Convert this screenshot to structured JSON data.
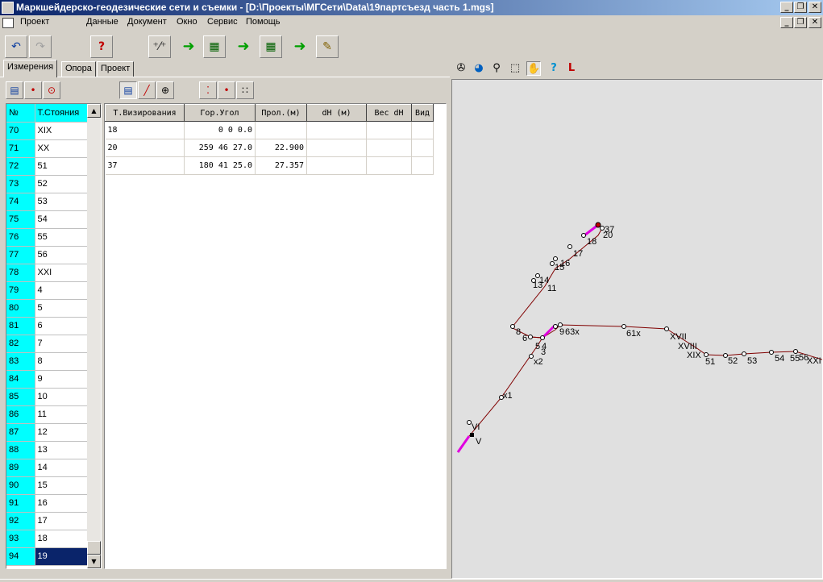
{
  "window": {
    "title": "Маркшейдерско-геодезические сети и съемки - [D:\\Проекты\\МГСети\\Data\\19партсъезд часть 1.mgs]",
    "btn_min": "_",
    "btn_restore": "❐",
    "btn_close": "✕"
  },
  "menu": {
    "doc_label": "Проект",
    "items": [
      "Данные",
      "Документ",
      "Окно",
      "Сервис",
      "Помощь"
    ]
  },
  "tabs": [
    "Измерения",
    "Опора",
    "Проект"
  ],
  "station_grid": {
    "col_num": "№",
    "col_station": "Т.Стояния",
    "rows": [
      {
        "n": "70",
        "s": "XIX"
      },
      {
        "n": "71",
        "s": "XX"
      },
      {
        "n": "72",
        "s": "51"
      },
      {
        "n": "73",
        "s": "52"
      },
      {
        "n": "74",
        "s": "53"
      },
      {
        "n": "75",
        "s": "54"
      },
      {
        "n": "76",
        "s": "55"
      },
      {
        "n": "77",
        "s": "56"
      },
      {
        "n": "78",
        "s": "XXI"
      },
      {
        "n": "79",
        "s": "4"
      },
      {
        "n": "80",
        "s": "5"
      },
      {
        "n": "81",
        "s": "6"
      },
      {
        "n": "82",
        "s": "7"
      },
      {
        "n": "83",
        "s": "8"
      },
      {
        "n": "84",
        "s": "9"
      },
      {
        "n": "85",
        "s": "10"
      },
      {
        "n": "86",
        "s": "11"
      },
      {
        "n": "87",
        "s": "12"
      },
      {
        "n": "88",
        "s": "13"
      },
      {
        "n": "89",
        "s": "14"
      },
      {
        "n": "90",
        "s": "15"
      },
      {
        "n": "91",
        "s": "16"
      },
      {
        "n": "92",
        "s": "17"
      },
      {
        "n": "93",
        "s": "18"
      },
      {
        "n": "94",
        "s": "19"
      }
    ],
    "selected_row": "94"
  },
  "measurement_grid": {
    "headers": [
      "Т.Визирования",
      "Гор.Угол",
      "Прол.(м)",
      "dH (м)",
      "Вес dH",
      "Вид"
    ],
    "rows": [
      [
        "18",
        "0  0  0.0",
        "",
        "",
        "",
        ""
      ],
      [
        "20",
        "259 46 27.0",
        "22.900",
        "",
        "",
        ""
      ],
      [
        "37",
        "180 41 25.0",
        "27.357",
        "",
        "",
        ""
      ]
    ]
  },
  "map_labels": {
    "p37": "37",
    "p20": "20",
    "p18": "18",
    "p17": "17",
    "p16": "16",
    "p15": "15",
    "p14": "14",
    "p13": "13",
    "p11": "11",
    "p8": "8",
    "p6": "6",
    "p5": "5",
    "p4": "4",
    "p3": "3",
    "p9": "9",
    "p63x": "63x",
    "p61x": "61x",
    "pXVII": "XVII",
    "pXVIII": "XVIII",
    "pXIX": "XIX",
    "p51": "51",
    "p52": "52",
    "p53": "53",
    "p54": "54",
    "p55": "55",
    "p56": "56",
    "pXXI": "XXI",
    "px2": "x2",
    "px1": "x1",
    "pVI": "VI",
    "pV": "V"
  }
}
